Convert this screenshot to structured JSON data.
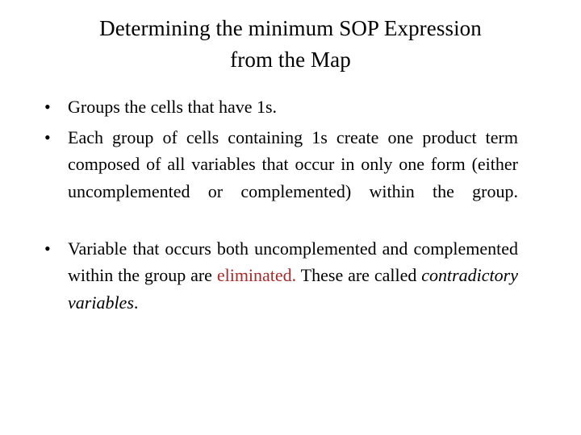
{
  "slide": {
    "title": {
      "line1": "Determining the minimum SOP Expression",
      "line2": "from the Map"
    },
    "bullet_marker": "•",
    "colors": {
      "text": "#000000",
      "background": "#ffffff",
      "highlight_red": "#a62a2a"
    },
    "bullets": [
      {
        "marker": "•",
        "text": "Groups the cells that have 1s."
      },
      {
        "marker": "•",
        "text": "Each group of cells containing 1s create one product term composed of all variables that occur in only one form (either uncomplemented or complemented) within the group."
      },
      {
        "marker": "•",
        "segment_plain_1": "Variable that occurs both uncomplemented and complemented within the group are ",
        "segment_red": "eliminated.",
        "segment_plain_2": " These are called ",
        "segment_italic": "contradictory variables",
        "segment_plain_3": "."
      }
    ]
  }
}
